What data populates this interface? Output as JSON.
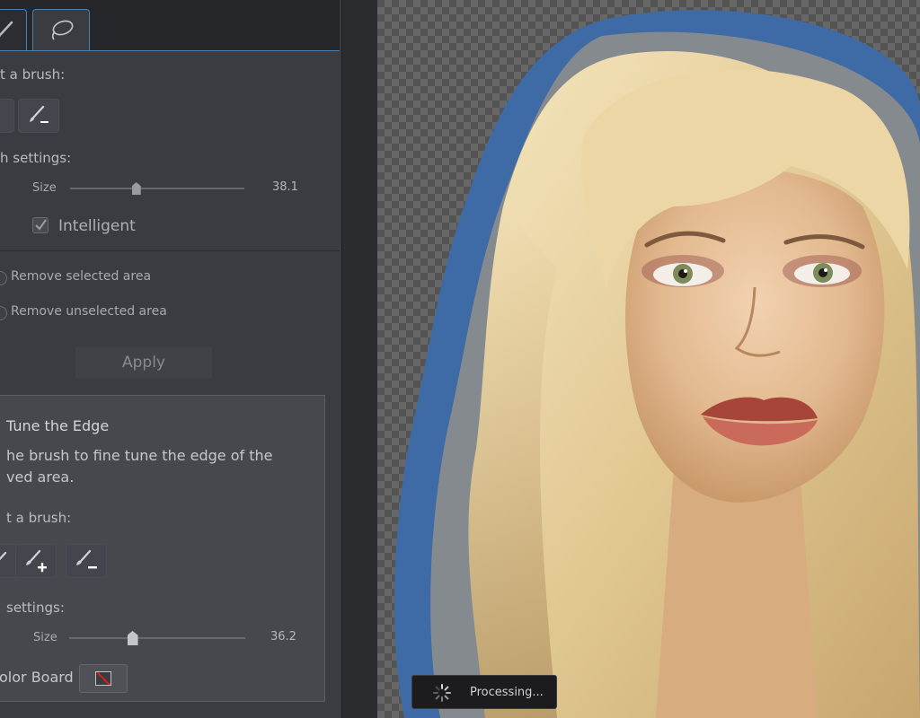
{
  "panel": {
    "select_brush_1": "t a brush:",
    "brush_settings_1": "h settings:",
    "size_label_1": "Size",
    "size_value_1": "38.1",
    "size_fraction_1": 0.38,
    "intelligent_label": "Intelligent",
    "intelligent_checked": true,
    "remove_selected": "Remove selected area",
    "remove_unselected": "Remove unselected area",
    "apply_label": "Apply",
    "fine_tune": {
      "title": "Tune the Edge",
      "description_1": "he brush to fine tune the edge of the",
      "description_2": "ved area.",
      "select_brush": "t a brush:",
      "brush_settings": "settings:",
      "size_label": "Size",
      "size_value": "36.2",
      "size_fraction": 0.36,
      "color_board_label": "olor Board"
    }
  },
  "status": {
    "processing": "Processing..."
  },
  "colors": {
    "accent": "#4a7fb0",
    "selection_mask": "#3e6aa6",
    "panel_bg": "#3b3c42"
  },
  "icons": {
    "tab_brush": "brush-icon",
    "tab_lasso": "lasso-icon",
    "brush_minus": "brush-minus-icon",
    "brush_plus": "brush-plus-icon",
    "spinner": "spinner-icon"
  }
}
